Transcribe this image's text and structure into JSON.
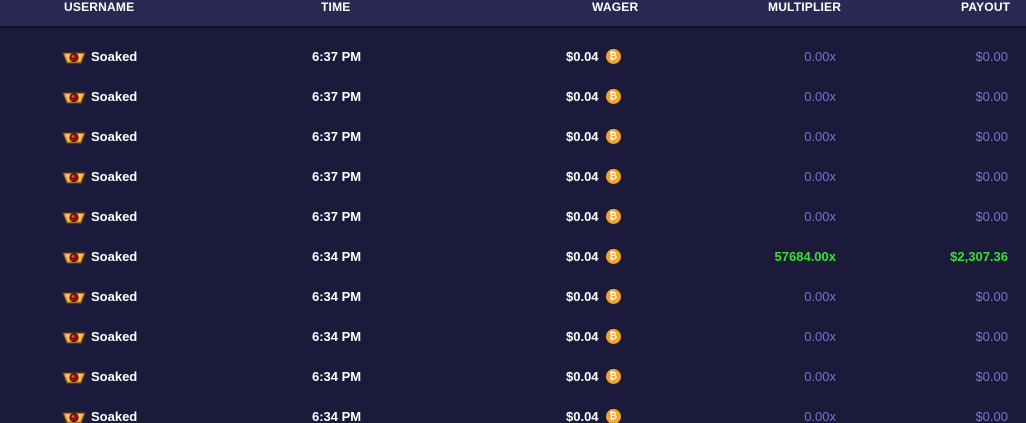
{
  "colors": {
    "background": "#1b1a3a",
    "header_background": "#2a2852",
    "win_green": "#39e02f",
    "muted_purple": "#7b73c9",
    "coin_orange": "#f5a524"
  },
  "header": {
    "username": "USERNAME",
    "time": "TIME",
    "wager": "WAGER",
    "multiplier": "MULTIPLIER",
    "payout": "PAYOUT"
  },
  "currency_icon": "bitcoin-icon",
  "badge_icon": "rank-badge-icon",
  "rows": [
    {
      "username": "Soaked",
      "time": "6:37 PM",
      "wager": "$0.04",
      "multiplier": "0.00x",
      "payout": "$0.00",
      "win": false
    },
    {
      "username": "Soaked",
      "time": "6:37 PM",
      "wager": "$0.04",
      "multiplier": "0.00x",
      "payout": "$0.00",
      "win": false
    },
    {
      "username": "Soaked",
      "time": "6:37 PM",
      "wager": "$0.04",
      "multiplier": "0.00x",
      "payout": "$0.00",
      "win": false
    },
    {
      "username": "Soaked",
      "time": "6:37 PM",
      "wager": "$0.04",
      "multiplier": "0.00x",
      "payout": "$0.00",
      "win": false
    },
    {
      "username": "Soaked",
      "time": "6:37 PM",
      "wager": "$0.04",
      "multiplier": "0.00x",
      "payout": "$0.00",
      "win": false
    },
    {
      "username": "Soaked",
      "time": "6:34 PM",
      "wager": "$0.04",
      "multiplier": "57684.00x",
      "payout": "$2,307.36",
      "win": true
    },
    {
      "username": "Soaked",
      "time": "6:34 PM",
      "wager": "$0.04",
      "multiplier": "0.00x",
      "payout": "$0.00",
      "win": false
    },
    {
      "username": "Soaked",
      "time": "6:34 PM",
      "wager": "$0.04",
      "multiplier": "0.00x",
      "payout": "$0.00",
      "win": false
    },
    {
      "username": "Soaked",
      "time": "6:34 PM",
      "wager": "$0.04",
      "multiplier": "0.00x",
      "payout": "$0.00",
      "win": false
    },
    {
      "username": "Soaked",
      "time": "6:34 PM",
      "wager": "$0.04",
      "multiplier": "0.00x",
      "payout": "$0.00",
      "win": false
    }
  ]
}
